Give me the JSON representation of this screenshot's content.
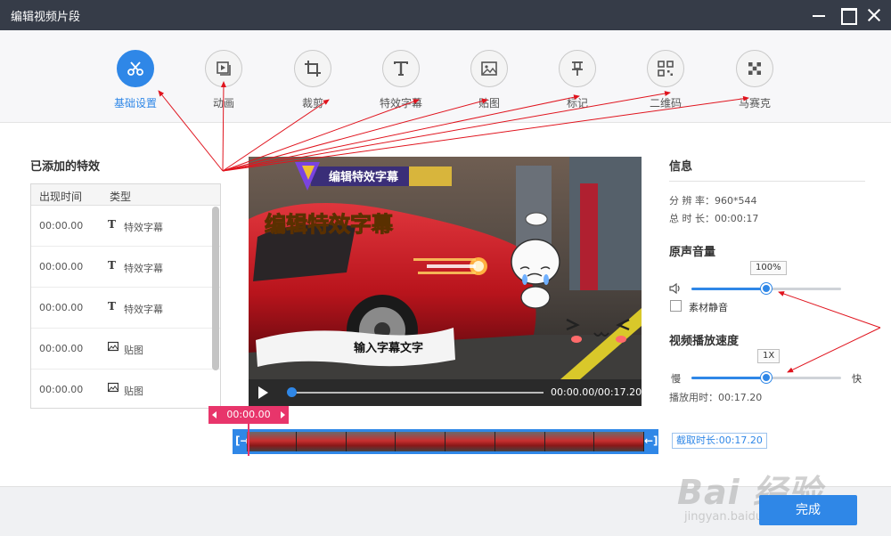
{
  "window": {
    "title": "编辑视频片段"
  },
  "toolbar": {
    "items": [
      {
        "label": "基础设置",
        "icon": "scissors-icon",
        "active": true
      },
      {
        "label": "动画",
        "icon": "animation-icon",
        "active": false
      },
      {
        "label": "裁剪",
        "icon": "crop-icon",
        "active": false
      },
      {
        "label": "特效字幕",
        "icon": "text-t-icon",
        "active": false
      },
      {
        "label": "贴图",
        "icon": "image-icon",
        "active": false
      },
      {
        "label": "标记",
        "icon": "pin-icon",
        "active": false
      },
      {
        "label": "二维码",
        "icon": "qrcode-icon",
        "active": false
      },
      {
        "label": "马赛克",
        "icon": "mosaic-icon",
        "active": false
      }
    ]
  },
  "effects": {
    "title": "已添加的特效",
    "col_time": "出现时间",
    "col_type": "类型",
    "rows": [
      {
        "time": "00:00.00",
        "type": "特效字幕",
        "icon": "text-t-icon"
      },
      {
        "time": "00:00.00",
        "type": "特效字幕",
        "icon": "text-t-icon"
      },
      {
        "time": "00:00.00",
        "type": "特效字幕",
        "icon": "text-t-icon"
      },
      {
        "time": "00:00.00",
        "type": "贴图",
        "icon": "image-icon"
      },
      {
        "time": "00:00.00",
        "type": "贴图",
        "icon": "image-icon"
      }
    ]
  },
  "video": {
    "banner_text": "编辑特效字幕",
    "big_caption": "编辑特效字幕",
    "brush_caption": "输入字幕文字",
    "time_readout": "00:00.00/00:17.20",
    "progress": 0
  },
  "timeline": {
    "current_time": "00:00.00",
    "clip_length": "截取时长:00:17.20",
    "frame_count": 8
  },
  "info": {
    "title": "信息",
    "resolution_label": "分 辨 率：",
    "resolution_value": "960*544",
    "duration_label": "总 时 长：",
    "duration_value": "00:00:17"
  },
  "volume": {
    "title": "原声音量",
    "value_text": "100%",
    "level": 0.5,
    "mute_label": "素材静音",
    "muted": false
  },
  "speed": {
    "title": "视频播放速度",
    "value_text": "1X",
    "level": 0.5,
    "slow_label": "慢",
    "fast_label": "快",
    "play_time_label": "播放用时：",
    "play_time_value": "00:17.20"
  },
  "footer": {
    "done_label": "完成"
  },
  "watermark": {
    "brand": "Bai 经验",
    "url": "jingyan.baidu.com"
  },
  "colors": {
    "accent": "#2f87e7",
    "titlebar": "#363c48",
    "timetag": "#e8356b",
    "annotation": "#e0141e"
  }
}
